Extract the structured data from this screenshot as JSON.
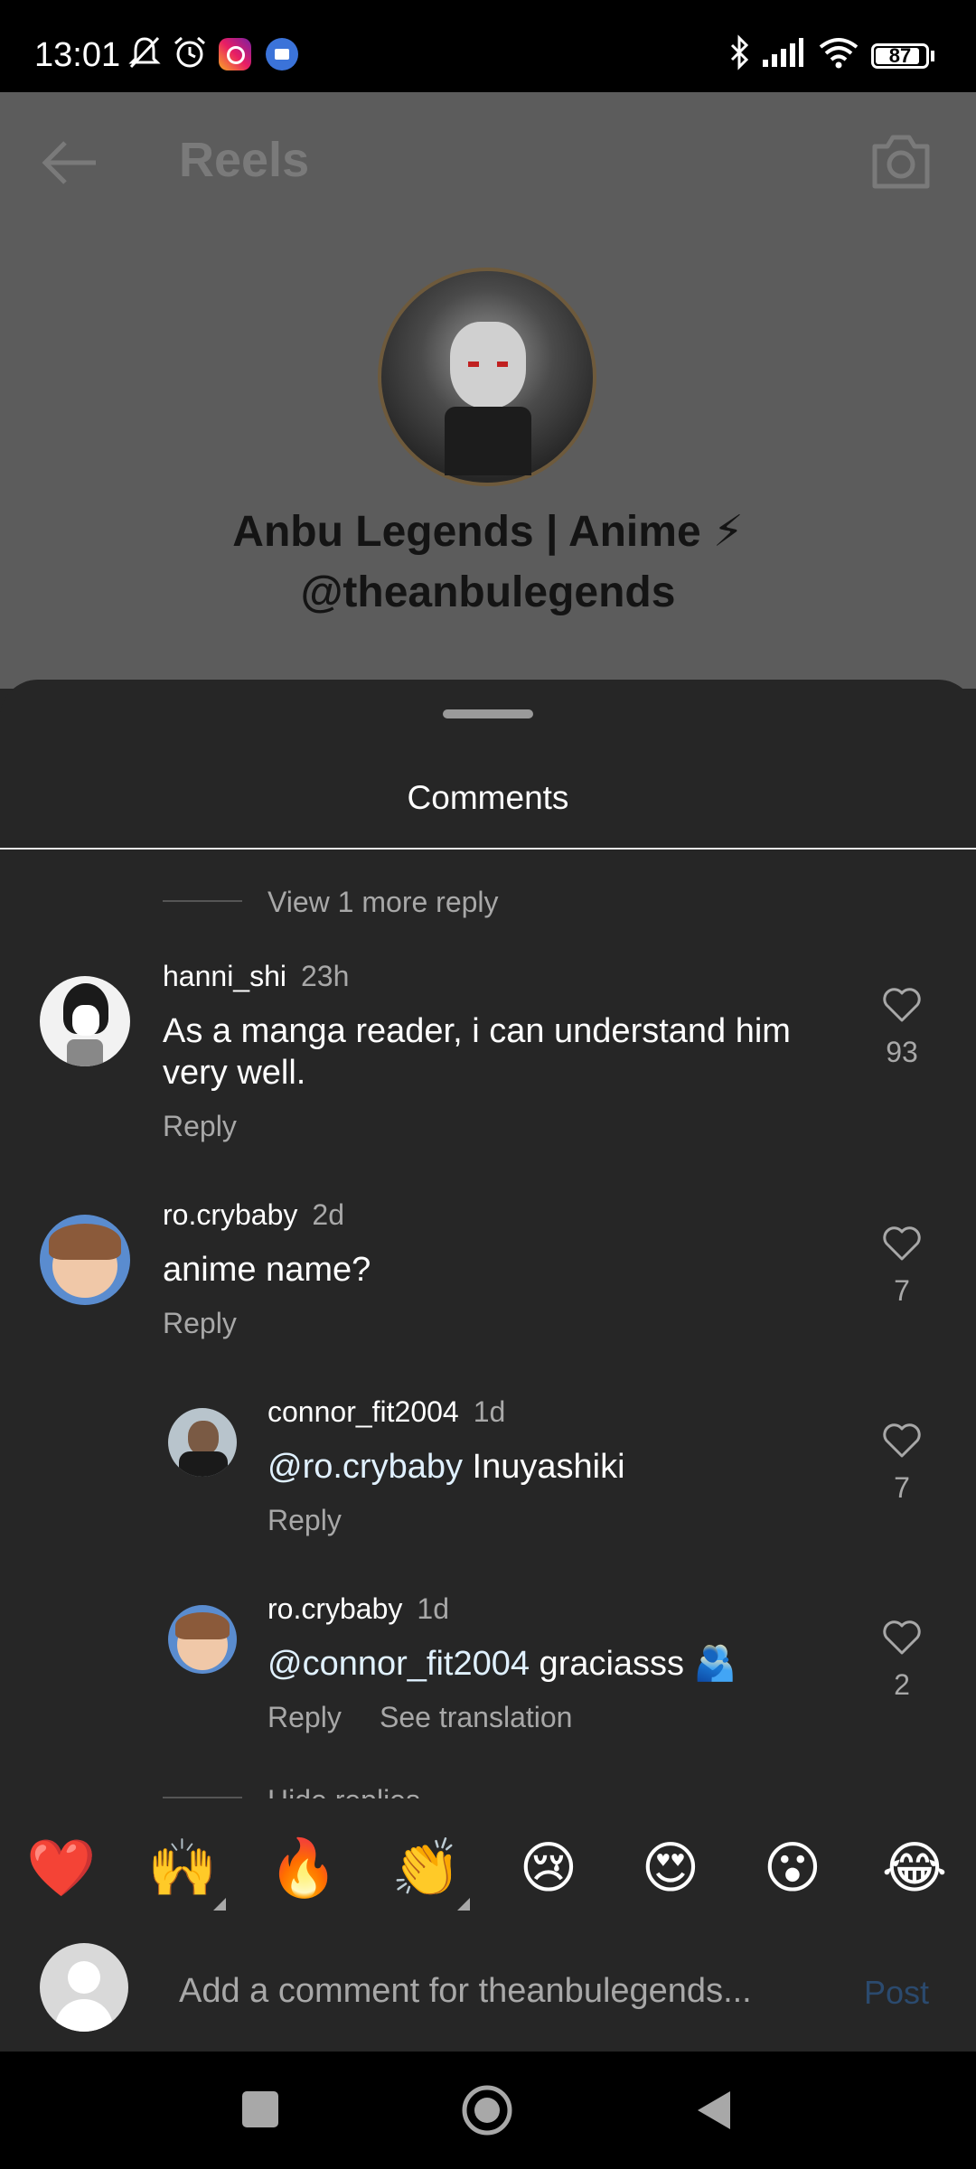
{
  "status_bar": {
    "time": "13:01",
    "battery": "87"
  },
  "header": {
    "title": "Reels"
  },
  "channel": {
    "name": "Anbu Legends | Anime ⚡",
    "handle": "@theanbulegends"
  },
  "sheet": {
    "title": "Comments"
  },
  "view_more_top": "View 1 more reply",
  "comments": [
    {
      "user": "hanni_shi",
      "time": "23h",
      "text": "As a manga reader, i can understand him",
      "text2": "very well.",
      "reply": "Reply",
      "likes": "93"
    },
    {
      "user": "ro.crybaby",
      "time": "2d",
      "text": "anime name?",
      "reply": "Reply",
      "likes": "7"
    },
    {
      "user": "connor_fit2004",
      "time": "1d",
      "mention": "@ro.crybaby",
      "text": " Inuyashiki",
      "reply": "Reply",
      "likes": "7"
    },
    {
      "user": "ro.crybaby",
      "time": "1d",
      "mention": "@connor_fit2004",
      "text": " graciasss 🫂",
      "reply": "Reply",
      "see_translation": "See translation",
      "likes": "2"
    }
  ],
  "hide_replies": "Hide replies",
  "emojis": [
    "❤️",
    "🙌",
    "🔥",
    "👏",
    "😢",
    "😍",
    "😮",
    "😂"
  ],
  "composer": {
    "placeholder": "Add a comment for theanbulegends...",
    "post": "Post"
  },
  "colors": {
    "sheet_bg": "#262626",
    "muted": "#a8a8a8",
    "post_disabled": "#2b4a6e"
  }
}
